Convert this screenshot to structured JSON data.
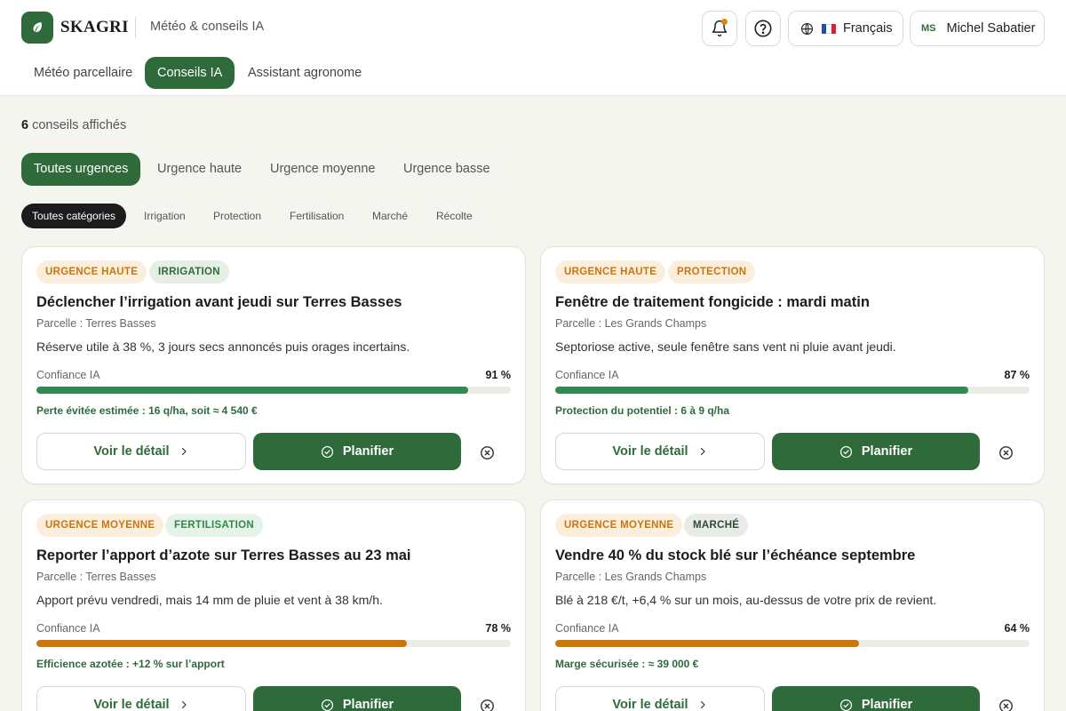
{
  "header": {
    "brand": "SKAGRI",
    "subtitle": "Météo & conseils IA",
    "language": "Français",
    "user_initials": "MS",
    "user_name": "Michel Sabatier",
    "tabs": [
      {
        "label": "Météo parcellaire",
        "active": false
      },
      {
        "label": "Conseils IA",
        "active": true
      },
      {
        "label": "Assistant agronome",
        "active": false
      }
    ]
  },
  "filters": {
    "count_number": "6",
    "count_label": " conseils affichés",
    "urgency": [
      {
        "label": "Toutes urgences",
        "active": true
      },
      {
        "label": "Urgence haute",
        "active": false
      },
      {
        "label": "Urgence moyenne",
        "active": false
      },
      {
        "label": "Urgence basse",
        "active": false
      }
    ],
    "categories": [
      {
        "label": "Toutes catégories",
        "active": true
      },
      {
        "label": "Irrigation",
        "active": false
      },
      {
        "label": "Protection",
        "active": false
      },
      {
        "label": "Fertilisation",
        "active": false
      },
      {
        "label": "Marché",
        "active": false
      },
      {
        "label": "Récolte",
        "active": false
      }
    ]
  },
  "cards": [
    {
      "urgency": "URGENCE HAUTE",
      "category": "IRRIGATION",
      "title": "Déclencher l’irrigation avant jeudi sur Terres Basses",
      "parcel": "Parcelle : Terres Basses",
      "description": "Réserve utile à 38 %, 3 jours secs annoncés puis orages incertains.",
      "confidence_label": "Confiance IA",
      "confidence_text": "91 %",
      "confidence": 0.91,
      "impact": "Perte évitée estimée : 16 q/ha, soit ≈ 4 540 €",
      "detail_label": "Voir le détail",
      "plan_label": "Planifier",
      "bar_color": "#2e8a52",
      "impact_color": "#2e6a3a"
    },
    {
      "urgency": "URGENCE HAUTE",
      "category": "PROTECTION",
      "title": "Fenêtre de traitement fongicide : mardi matin",
      "parcel": "Parcelle : Les Grands Champs",
      "description": "Septoriose active, seule fenêtre sans vent ni pluie avant jeudi.",
      "confidence_label": "Confiance IA",
      "confidence_text": "87 %",
      "confidence": 0.87,
      "impact": "Protection du potentiel : 6 à 9 q/ha",
      "detail_label": "Voir le détail",
      "plan_label": "Planifier",
      "bar_color": "#2e8a52",
      "impact_color": "#2e6a3a"
    },
    {
      "urgency": "URGENCE MOYENNE",
      "category": "FERTILISATION",
      "title": "Reporter l’apport d’azote sur Terres Basses au 23 mai",
      "parcel": "Parcelle : Terres Basses",
      "description": "Apport prévu vendredi, mais 14 mm de pluie et vent à 38 km/h.",
      "confidence_label": "Confiance IA",
      "confidence_text": "78 %",
      "confidence": 0.78,
      "impact": "Efficience azotée : +12 % sur l’apport",
      "detail_label": "Voir le détail",
      "plan_label": "Planifier",
      "bar_color": "#c9770c",
      "impact_color": "#2e6a3a"
    },
    {
      "urgency": "URGENCE MOYENNE",
      "category": "MARCHÉ",
      "title": "Vendre 40 % du stock blé sur l’échéance septembre",
      "parcel": "Parcelle : Les Grands Champs",
      "description": "Blé à 218 €/t, +6,4 % sur un mois, au-dessus de votre prix de revient.",
      "confidence_label": "Confiance IA",
      "confidence_text": "64 %",
      "confidence": 0.64,
      "impact": "Marge sécurisée : ≈ 39 000 €",
      "detail_label": "Voir le détail",
      "plan_label": "Planifier",
      "bar_color": "#c9770c",
      "impact_color": "#2e6a3a"
    }
  ]
}
